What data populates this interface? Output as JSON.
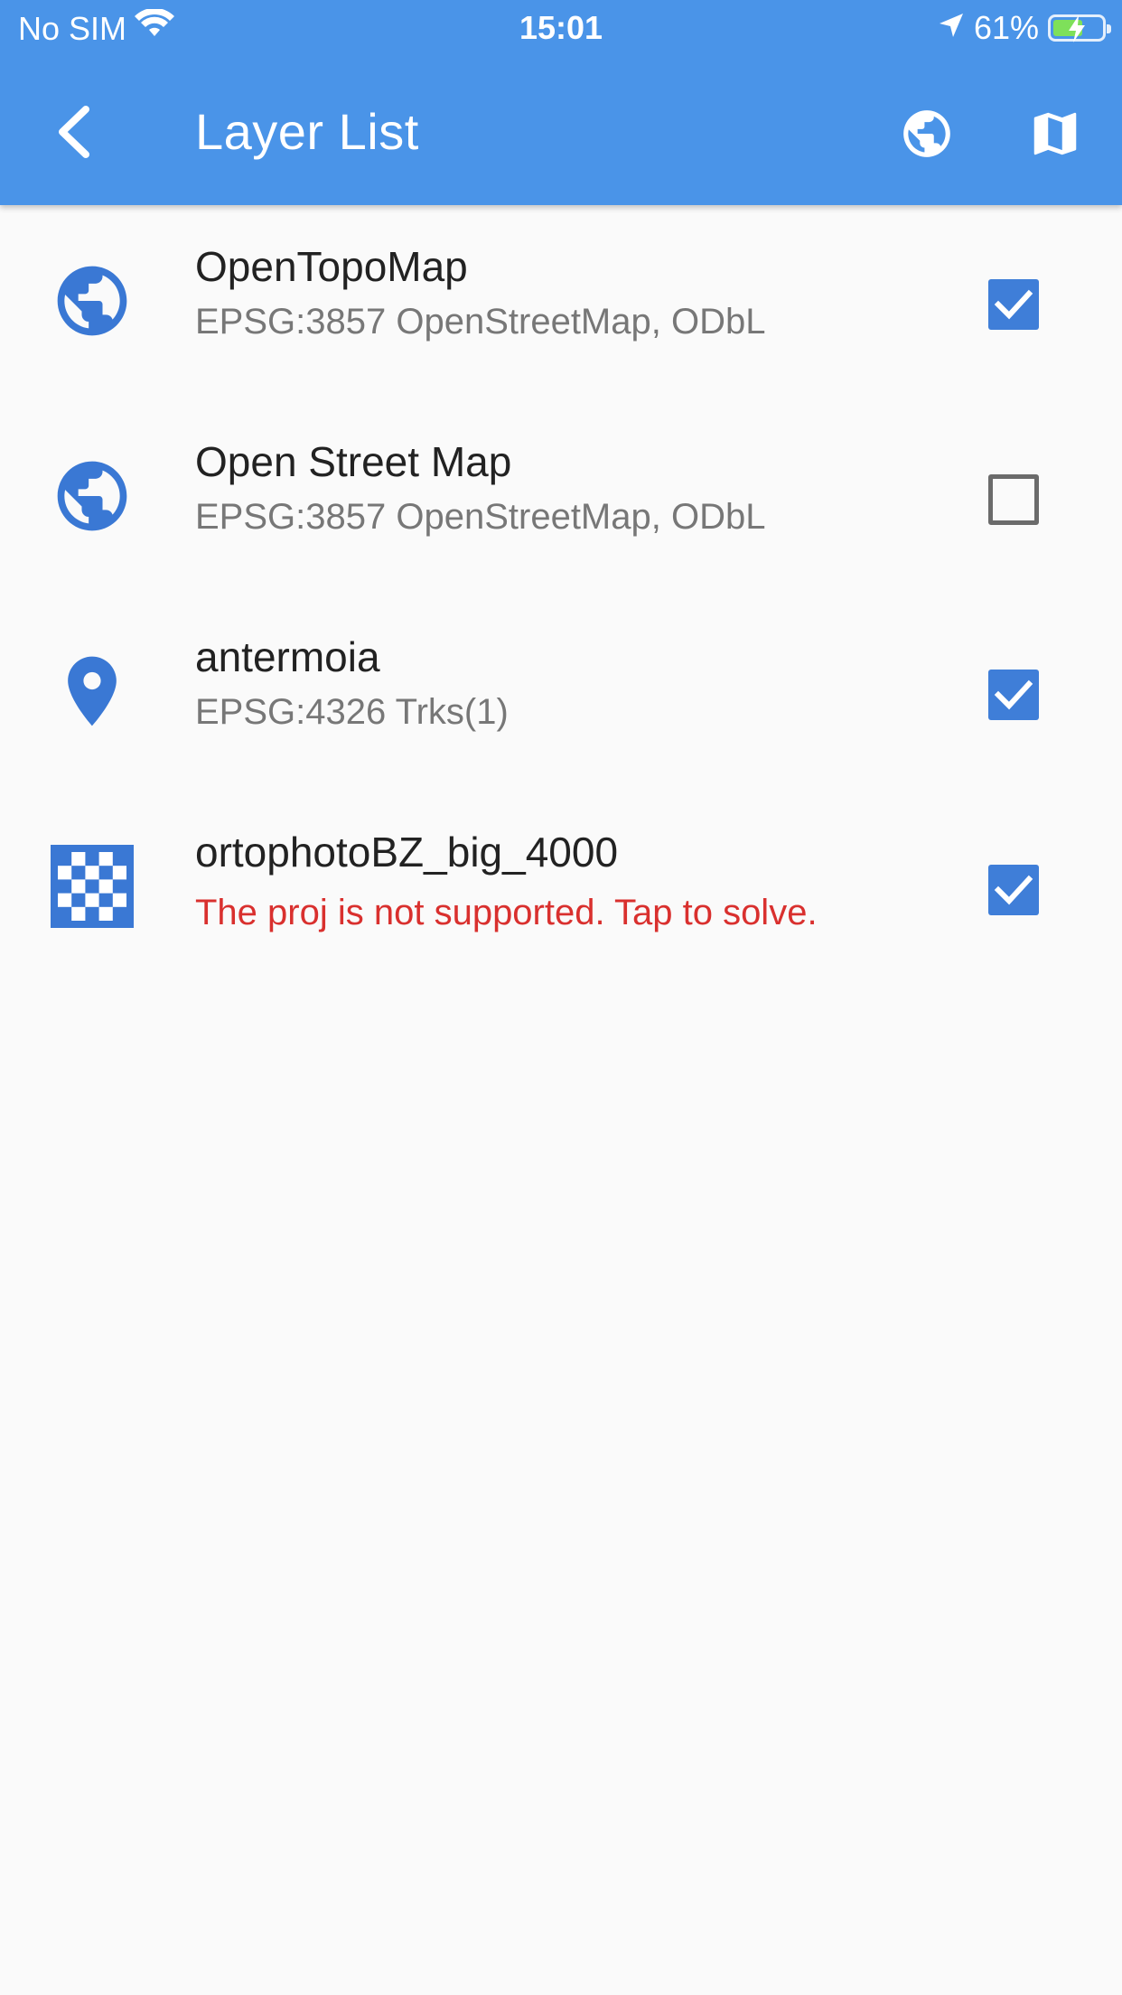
{
  "status_bar": {
    "carrier": "No SIM",
    "time": "15:01",
    "battery": "61%",
    "battery_level": 0.61
  },
  "app_bar": {
    "title": "Layer List",
    "back_icon": "back-arrow-icon",
    "actions": [
      {
        "icon": "globe-icon"
      },
      {
        "icon": "map-icon"
      }
    ]
  },
  "layers": [
    {
      "icon": "globe-icon",
      "title": "OpenTopoMap",
      "subtitle": "EPSG:3857 OpenStreetMap, ODbL",
      "subtitle_is_error": false,
      "checked": true
    },
    {
      "icon": "globe-icon",
      "title": "Open Street Map",
      "subtitle": "EPSG:3857 OpenStreetMap, ODbL",
      "subtitle_is_error": false,
      "checked": false
    },
    {
      "icon": "location-pin-icon",
      "title": "antermoia",
      "subtitle": "EPSG:4326 Trks(1)",
      "subtitle_is_error": false,
      "checked": true
    },
    {
      "icon": "checkerboard-icon",
      "title": "ortophotoBZ_big_4000",
      "subtitle": "The proj is not supported. Tap to solve.",
      "subtitle_is_error": true,
      "checked": true
    }
  ],
  "colors": {
    "primary": "#4a94e8",
    "icon_blue": "#3a78d4",
    "checkbox_blue": "#3f7ed8",
    "error_red": "#d9302e",
    "background": "#fafafa"
  }
}
